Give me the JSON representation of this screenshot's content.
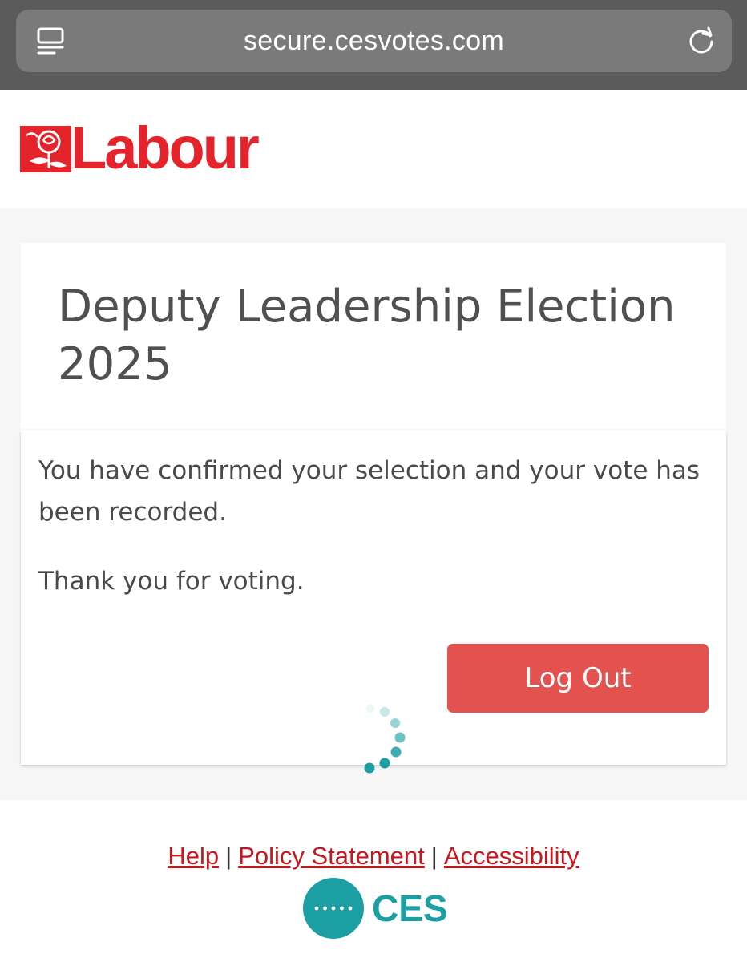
{
  "browser": {
    "url": "secure.cesvotes.com",
    "reader_icon": "reader-mode-icon",
    "reload_icon": "reload-icon"
  },
  "header": {
    "logo_text": "Labour",
    "logo_icon": "rose-icon",
    "brand_color": "#e4232b"
  },
  "main": {
    "title": "Deputy Leadership Election 2025",
    "message": "You have confirmed your selection and your vote has been recorded.",
    "thanks": "Thank you for voting.",
    "logout_label": "Log Out",
    "button_color": "#e4524f",
    "loading_icon": "loading-spinner-icon"
  },
  "footer": {
    "links": [
      "Help",
      "Policy Statement",
      "Accessibility"
    ],
    "separator": "|",
    "provider_text": "CES",
    "provider_color": "#1b9fa3"
  }
}
